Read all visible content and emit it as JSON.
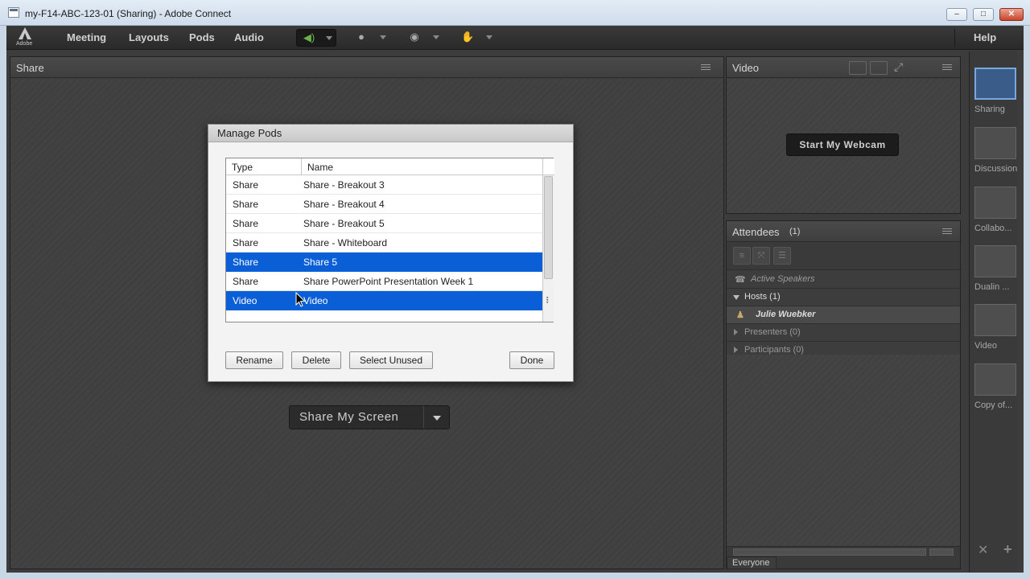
{
  "window": {
    "title": "my-F14-ABC-123-01 (Sharing) - Adobe Connect",
    "minimize": "–",
    "maximize": "□",
    "close": "✕"
  },
  "menubar": {
    "logo_text": "Adobe",
    "items": [
      "Meeting",
      "Layouts",
      "Pods",
      "Audio"
    ],
    "help": "Help"
  },
  "share_pod": {
    "title": "Share",
    "share_screen_button": "Share My Screen"
  },
  "video_pod": {
    "title": "Video",
    "start_webcam_button": "Start My Webcam"
  },
  "attendees_pod": {
    "title": "Attendees",
    "count": "(1)",
    "active_speakers": "Active Speakers",
    "hosts": "Hosts (1)",
    "host_user": "Julie Wuebker",
    "presenters": "Presenters (0)",
    "participants": "Participants (0)",
    "chat_target": "Everyone"
  },
  "layouts": [
    {
      "label": "Sharing",
      "selected": true
    },
    {
      "label": "Discussion",
      "selected": false
    },
    {
      "label": "Collabo...",
      "selected": false
    },
    {
      "label": "Dualin ...",
      "selected": false
    },
    {
      "label": "Video",
      "selected": false
    },
    {
      "label": "Copy of...",
      "selected": false
    }
  ],
  "manage_pods": {
    "title": "Manage Pods",
    "columns": {
      "type": "Type",
      "name": "Name"
    },
    "rows": [
      {
        "type": "Share",
        "name": "Share - Breakout 3",
        "selected": false
      },
      {
        "type": "Share",
        "name": "Share - Breakout 4",
        "selected": false
      },
      {
        "type": "Share",
        "name": "Share - Breakout 5",
        "selected": false
      },
      {
        "type": "Share",
        "name": "Share - Whiteboard",
        "selected": false
      },
      {
        "type": "Share",
        "name": "Share 5",
        "selected": true
      },
      {
        "type": "Share",
        "name": "Share PowerPoint Presentation Week 1",
        "selected": false
      },
      {
        "type": "Video",
        "name": "Video",
        "selected": true
      }
    ],
    "buttons": {
      "rename": "Rename",
      "delete": "Delete",
      "select_unused": "Select Unused",
      "done": "Done"
    }
  }
}
